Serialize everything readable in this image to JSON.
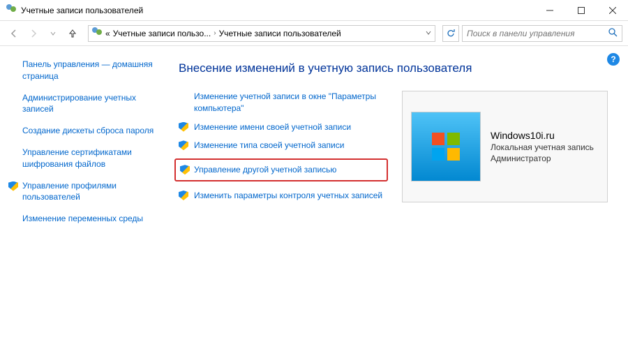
{
  "titlebar": {
    "title": "Учетные записи пользователей"
  },
  "toolbar": {
    "breadcrumb": {
      "chevrons": "«",
      "item1": "Учетные записи пользо...",
      "item2": "Учетные записи пользователей"
    },
    "search_placeholder": "Поиск в панели управления"
  },
  "sidebar": {
    "home": "Панель управления — домашняя страница",
    "items": [
      {
        "label": "Администрирование учетных записей",
        "shield": false
      },
      {
        "label": "Создание дискеты сброса пароля",
        "shield": false
      },
      {
        "label": "Управление сертификатами шифрования файлов",
        "shield": false
      },
      {
        "label": "Управление профилями пользователей",
        "shield": true
      },
      {
        "label": "Изменение переменных среды",
        "shield": false
      }
    ]
  },
  "main": {
    "title": "Внесение изменений в учетную запись пользователя",
    "links": [
      {
        "label": "Изменение учетной записи в окне \"Параметры компьютера\"",
        "shield": false,
        "highlight": false
      },
      {
        "label": "Изменение имени своей учетной записи",
        "shield": true,
        "highlight": false
      },
      {
        "label": "Изменение типа своей учетной записи",
        "shield": true,
        "highlight": false
      },
      {
        "label": "Управление другой учетной записью",
        "shield": true,
        "highlight": true
      },
      {
        "label": "Изменить параметры контроля учетных записей",
        "shield": true,
        "highlight": false
      }
    ],
    "account": {
      "name": "Windows10i.ru",
      "type": "Локальная учетная запись",
      "role": "Администратор"
    }
  },
  "help": "?"
}
